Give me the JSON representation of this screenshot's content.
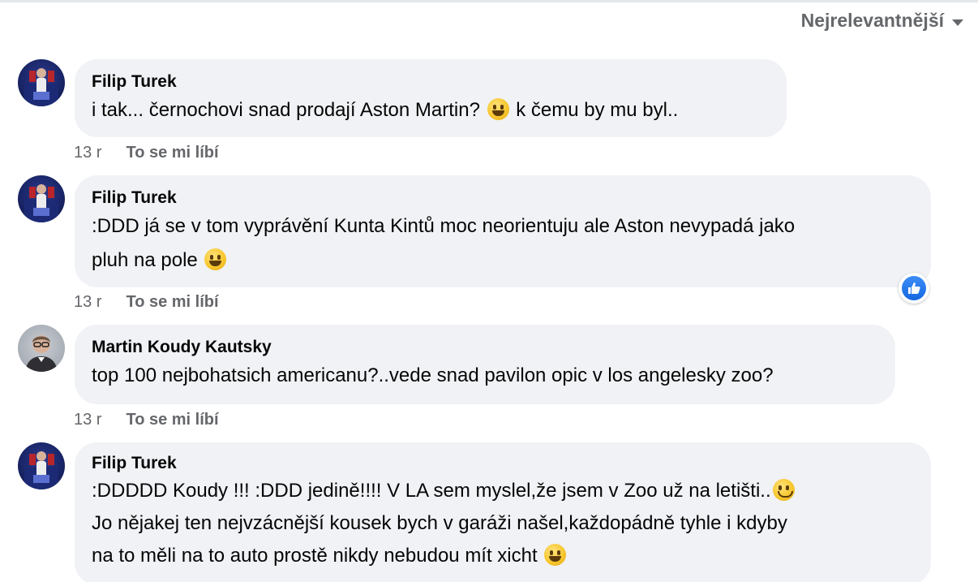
{
  "sort": {
    "label": "Nejrelevantnější",
    "icon": "caret-down-icon"
  },
  "comments": [
    {
      "author": "Filip Turek",
      "text_parts": [
        "i tak... černochovi snad prodají Aston Martin? ",
        " k čemu by mu byl.."
      ],
      "time": "13 r",
      "like": "To se mi líbí"
    },
    {
      "author": "Filip Turek",
      "line1": ":DDD já se v tom vyprávění Kunta Kintů moc neorientuju ale Aston nevypadá jako",
      "line2": "pluh na pole ",
      "time": "13 r",
      "like": "To se mi líbí",
      "reaction": "like-icon"
    },
    {
      "author": "Martin Koudy Kautsky",
      "text": "top 100 nejbohatsich americanu?..vede snad pavilon opic v los angelesky zoo?",
      "time": "13 r",
      "like": "To se mi líbí"
    },
    {
      "author": "Filip Turek",
      "line1": ":DDDDD Koudy !!! :DDD jedině!!!! V LA sem myslel,že jsem v Zoo už na letišti..",
      "line2": "Jo nějakej ten nejvzácnější kousek bych v garáži našel,každopádně tyhle i kdyby",
      "line3": "na to měli na to auto prostě nikdy nebudou mít xicht "
    }
  ],
  "colors": {
    "bubble": "#f0f2f5",
    "meta": "#65676b",
    "like_blue": "#1877f2"
  }
}
